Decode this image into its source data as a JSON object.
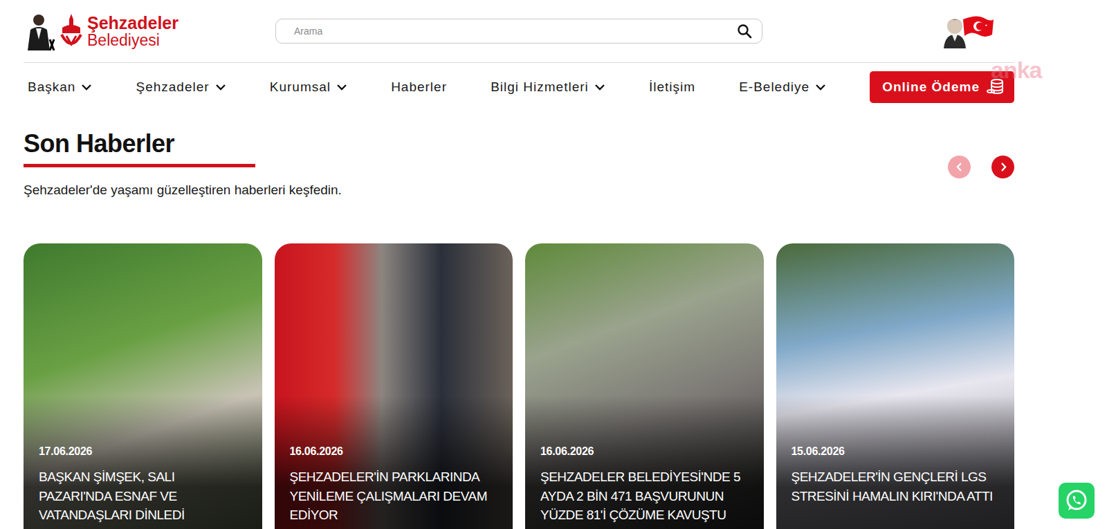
{
  "header": {
    "logo": {
      "line1": "Şehzadeler",
      "line2": "Belediyesi"
    },
    "search": {
      "placeholder": "Arama"
    }
  },
  "nav": {
    "items": [
      {
        "label": "Başkan",
        "has_dropdown": true
      },
      {
        "label": "Şehzadeler",
        "has_dropdown": true
      },
      {
        "label": "Kurumsal",
        "has_dropdown": true
      },
      {
        "label": "Haberler",
        "has_dropdown": false
      },
      {
        "label": "Bilgi Hizmetleri",
        "has_dropdown": true
      },
      {
        "label": "İletişim",
        "has_dropdown": false
      },
      {
        "label": "E-Belediye",
        "has_dropdown": true
      }
    ],
    "payment_button": "Online Ödeme"
  },
  "watermark": "anka",
  "news": {
    "title": "Son Haberler",
    "subtitle": "Şehzadeler'de yaşamı güzelleştiren haberleri keşfedin.",
    "carousel": {
      "prev_disabled": true,
      "next_disabled": false
    },
    "cards": [
      {
        "date": "17.06.2026",
        "title": "BAŞKAN ŞİMŞEK, SALI PAZARI'NDA ESNAF VE VATANDAŞLARI DİNLEDİ"
      },
      {
        "date": "16.06.2026",
        "title": "ŞEHZADELER'İN PARKLARINDA YENİLEME ÇALIŞMALARI DEVAM EDİYOR"
      },
      {
        "date": "16.06.2026",
        "title": "ŞEHZADELER BELEDİYESİ'NDE 5 AYDA 2 BİN 471 BAŞVURUNUN YÜZDE 81'İ ÇÖZÜME KAVUŞTU"
      },
      {
        "date": "15.06.2026",
        "title": "ŞEHZADELER'İN GENÇLERİ LGS STRESİNİ HAMALIN KIRI'NDA ATTI"
      }
    ]
  }
}
